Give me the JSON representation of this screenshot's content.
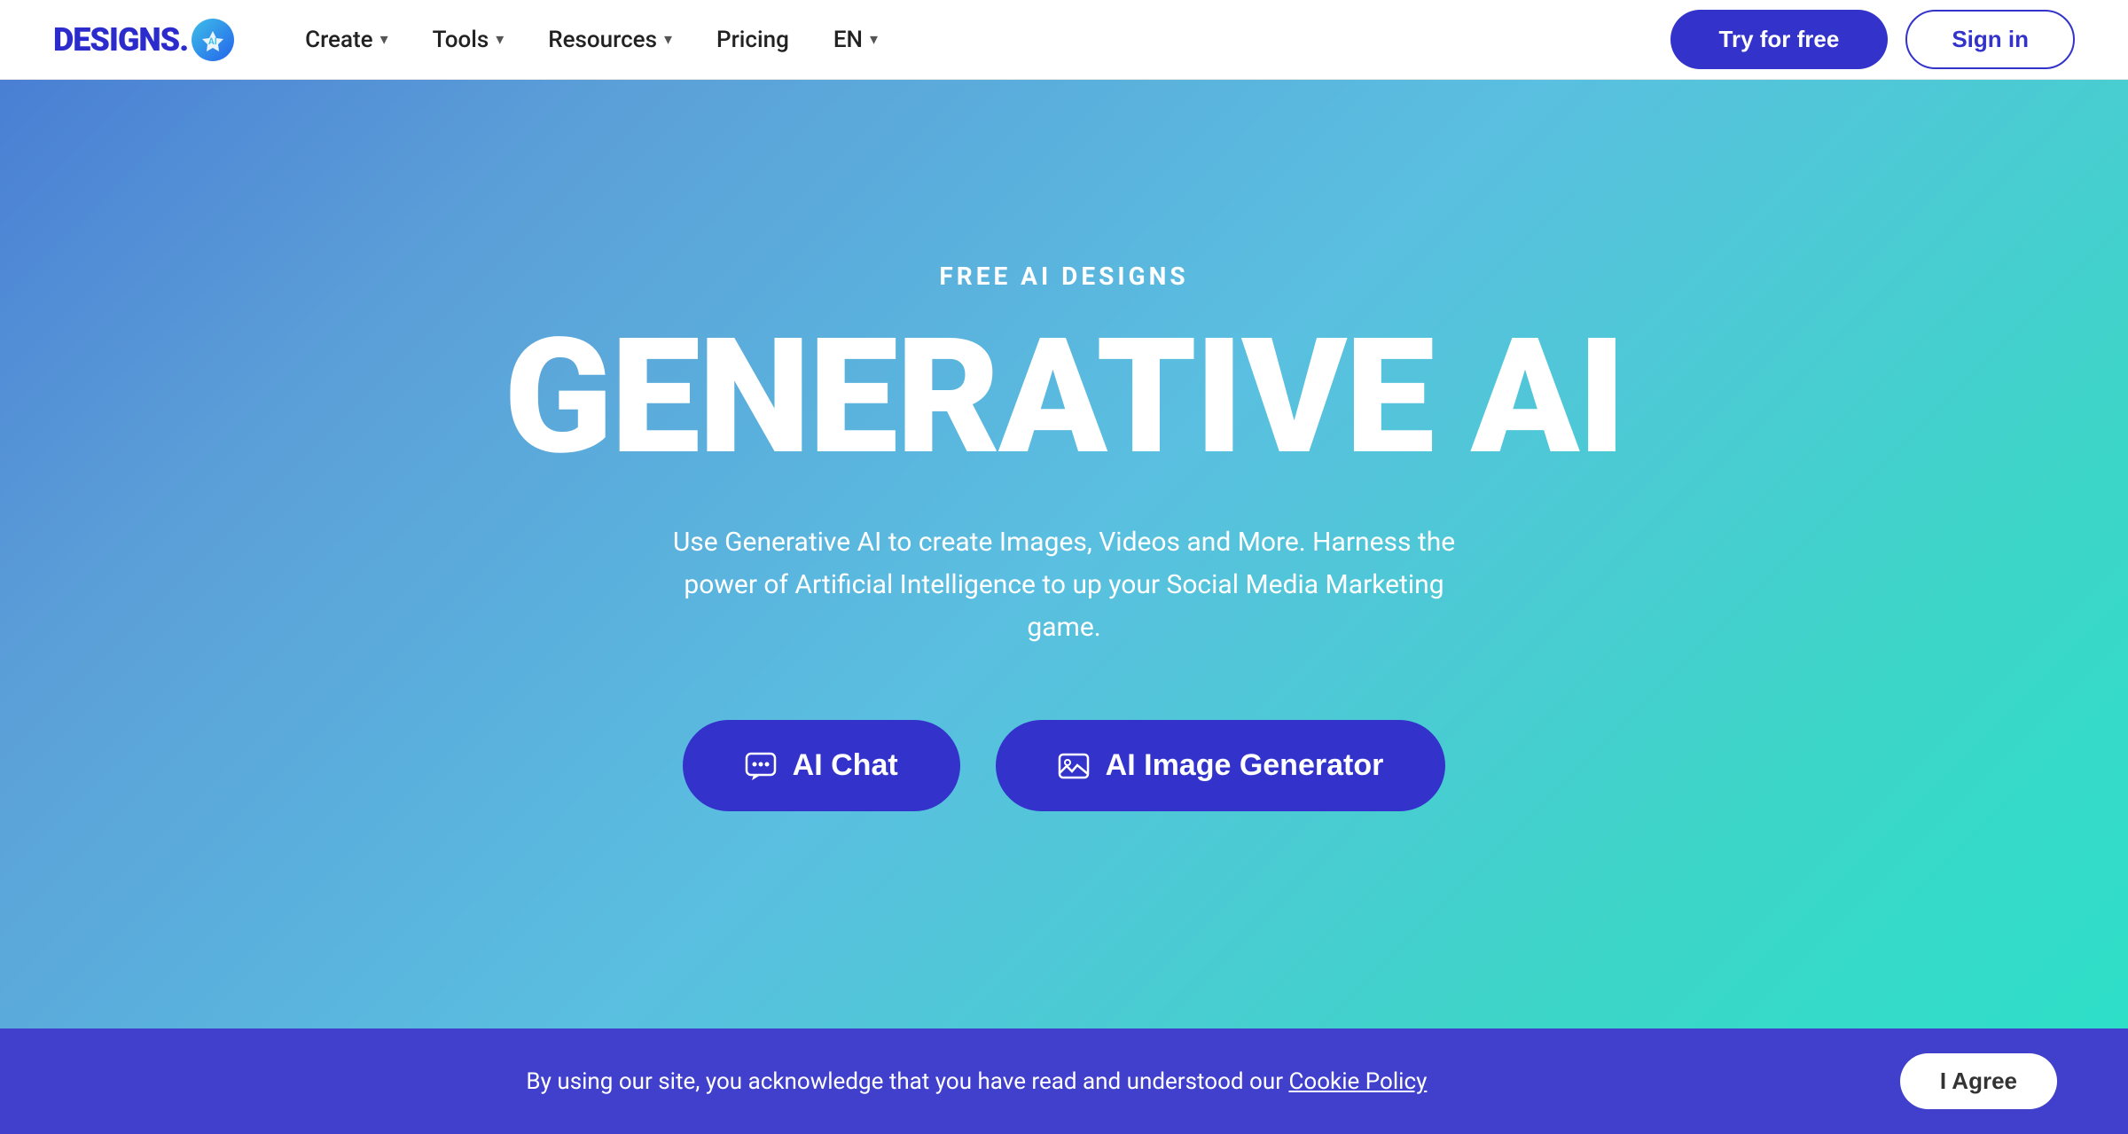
{
  "navbar": {
    "logo_text": "DESIGNS.",
    "nav_items": [
      {
        "label": "Create",
        "has_arrow": true
      },
      {
        "label": "Tools",
        "has_arrow": true
      },
      {
        "label": "Resources",
        "has_arrow": true
      },
      {
        "label": "Pricing",
        "has_arrow": false
      }
    ],
    "lang": "EN",
    "try_label": "Try for free",
    "signin_label": "Sign in"
  },
  "hero": {
    "subtitle": "FREE AI DESIGNS",
    "title": "GENERATIVE AI",
    "description": "Use Generative AI to create Images, Videos and More. Harness the power of Artificial Intelligence to up your Social Media Marketing game.",
    "btn_chat": "AI Chat",
    "btn_image": "AI Image Generator"
  },
  "cookie": {
    "text": "By using our site, you acknowledge that you have read and understood our ",
    "link_text": "Cookie Policy",
    "btn_label": "I Agree"
  }
}
